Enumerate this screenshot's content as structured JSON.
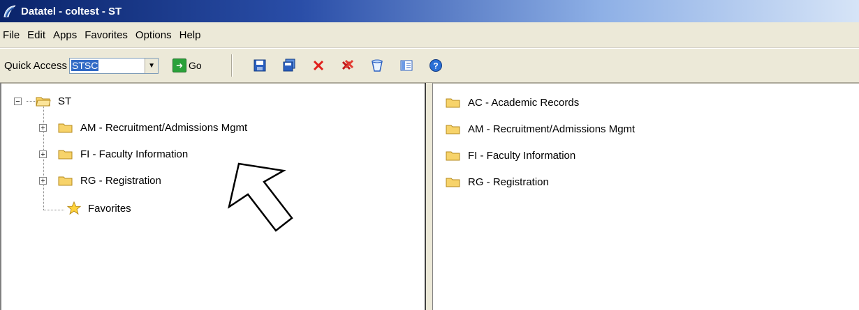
{
  "window": {
    "title": "Datatel - coltest - ST"
  },
  "menu": [
    "File",
    "Edit",
    "Apps",
    "Favorites",
    "Options",
    "Help"
  ],
  "toolbar": {
    "quick_access_label": "Quick Access",
    "quick_access_value": "STSC",
    "go_label": "Go",
    "icons": [
      "save-icon",
      "save-all-icon",
      "cancel-icon",
      "cancel-all-icon",
      "clear-icon",
      "list-icon",
      "help-icon"
    ]
  },
  "tree": {
    "root": "ST",
    "items": [
      {
        "label": "AM - Recruitment/Admissions Mgmt",
        "expandable": true
      },
      {
        "label": "FI - Faculty Information",
        "expandable": true
      },
      {
        "label": "RG - Registration",
        "expandable": true
      },
      {
        "label": "Favorites",
        "expandable": false
      }
    ]
  },
  "list": {
    "items": [
      {
        "label": "AC - Academic Records"
      },
      {
        "label": "AM - Recruitment/Admissions Mgmt"
      },
      {
        "label": "FI - Faculty Information"
      },
      {
        "label": "RG - Registration"
      }
    ]
  }
}
